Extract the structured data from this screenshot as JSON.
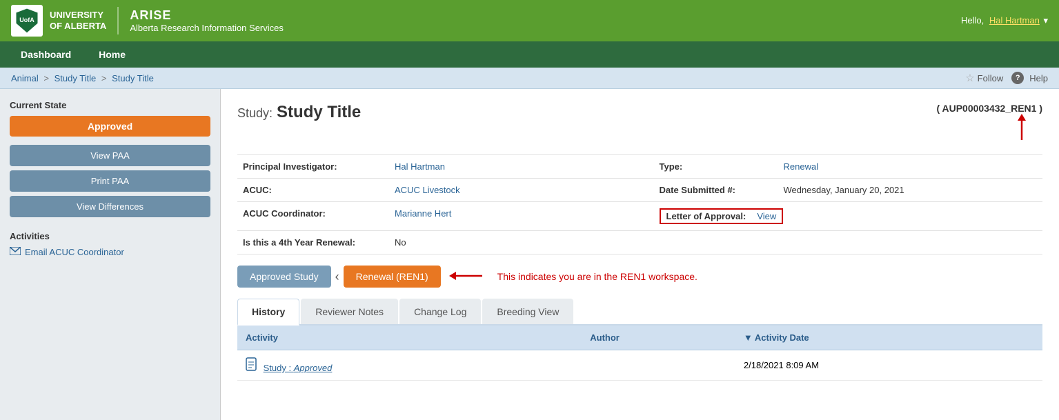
{
  "header": {
    "university_line1": "UNIVERSITY",
    "university_line2": "OF ALBERTA",
    "arise_label": "ARISE",
    "arise_subtitle": "Alberta Research Information Services",
    "greeting": "Hello,",
    "username": "Hal Hartman"
  },
  "nav": {
    "items": [
      {
        "label": "Dashboard",
        "id": "dashboard"
      },
      {
        "label": "Home",
        "id": "home"
      }
    ]
  },
  "breadcrumb": {
    "items": [
      {
        "label": "Animal",
        "link": true
      },
      {
        "label": "Study Title",
        "link": true
      },
      {
        "label": "Study Title",
        "link": false
      }
    ],
    "follow_label": "Follow",
    "help_label": "Help"
  },
  "sidebar": {
    "current_state_label": "Current State",
    "state_value": "Approved",
    "buttons": [
      {
        "label": "View PAA",
        "id": "view-paa"
      },
      {
        "label": "Print PAA",
        "id": "print-paa"
      },
      {
        "label": "View Differences",
        "id": "view-differences"
      }
    ],
    "activities_label": "Activities",
    "activity_links": [
      {
        "label": "Email ACUC Coordinator",
        "id": "email-acuc"
      }
    ]
  },
  "study": {
    "label": "Study:",
    "title": "Study Title",
    "id_badge": "( AUP00003432_REN1 )",
    "fields": {
      "principal_investigator_label": "Principal Investigator:",
      "principal_investigator_value": "Hal Hartman",
      "type_label": "Type:",
      "type_value": "Renewal",
      "acuc_label": "ACUC:",
      "acuc_value": "ACUC Livestock",
      "date_submitted_label": "Date Submitted #:",
      "date_submitted_value": "Wednesday, January 20, 2021",
      "acuc_coordinator_label": "ACUC Coordinator:",
      "acuc_coordinator_value": "Marianne Hert",
      "letter_of_approval_label": "Letter of Approval:",
      "letter_of_approval_link": "View",
      "fourth_year_renewal_label": "Is this a 4th Year Renewal:",
      "fourth_year_renewal_value": "No"
    }
  },
  "study_nav": {
    "approved_study_label": "Approved Study",
    "renewal_label": "Renewal (REN1)",
    "annotation": "This indicates you are in the REN1 workspace."
  },
  "tabs": [
    {
      "label": "History",
      "active": true
    },
    {
      "label": "Reviewer Notes",
      "active": false
    },
    {
      "label": "Change Log",
      "active": false
    },
    {
      "label": "Breeding View",
      "active": false
    }
  ],
  "history_table": {
    "columns": [
      {
        "label": "Activity",
        "id": "activity"
      },
      {
        "label": "Author",
        "id": "author"
      },
      {
        "label": "▼ Activity Date",
        "id": "activity-date",
        "sortable": true
      }
    ],
    "rows": [
      {
        "activity": "Study : Approved",
        "author": "",
        "date": "2/18/2021 8:09 AM",
        "has_icon": true
      }
    ]
  }
}
